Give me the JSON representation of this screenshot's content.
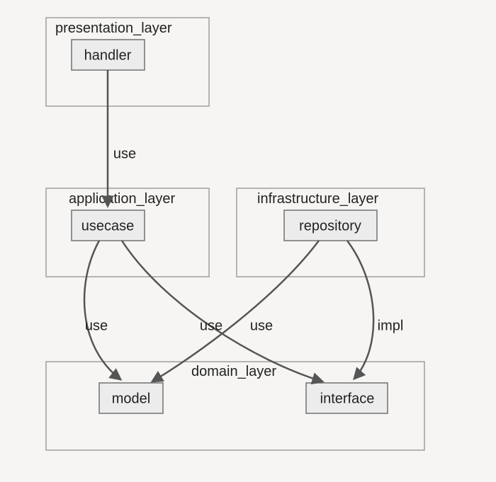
{
  "layers": {
    "presentation": {
      "title": "presentation_layer"
    },
    "application": {
      "title": "application_layer"
    },
    "infrastructure": {
      "title": "infrastructure_layer"
    },
    "domain": {
      "title": "domain_layer"
    }
  },
  "nodes": {
    "handler": {
      "label": "handler"
    },
    "usecase": {
      "label": "usecase"
    },
    "repository": {
      "label": "repository"
    },
    "model": {
      "label": "model"
    },
    "interface": {
      "label": "interface"
    }
  },
  "edges": {
    "handler_usecase": {
      "label": "use",
      "from": "handler",
      "to": "usecase"
    },
    "usecase_model": {
      "label": "use",
      "from": "usecase",
      "to": "model"
    },
    "usecase_interface": {
      "label": "use",
      "from": "usecase",
      "to": "interface"
    },
    "repository_model": {
      "label": "use",
      "from": "repository",
      "to": "model"
    },
    "repository_interface": {
      "label": "impl",
      "from": "repository",
      "to": "interface"
    }
  }
}
